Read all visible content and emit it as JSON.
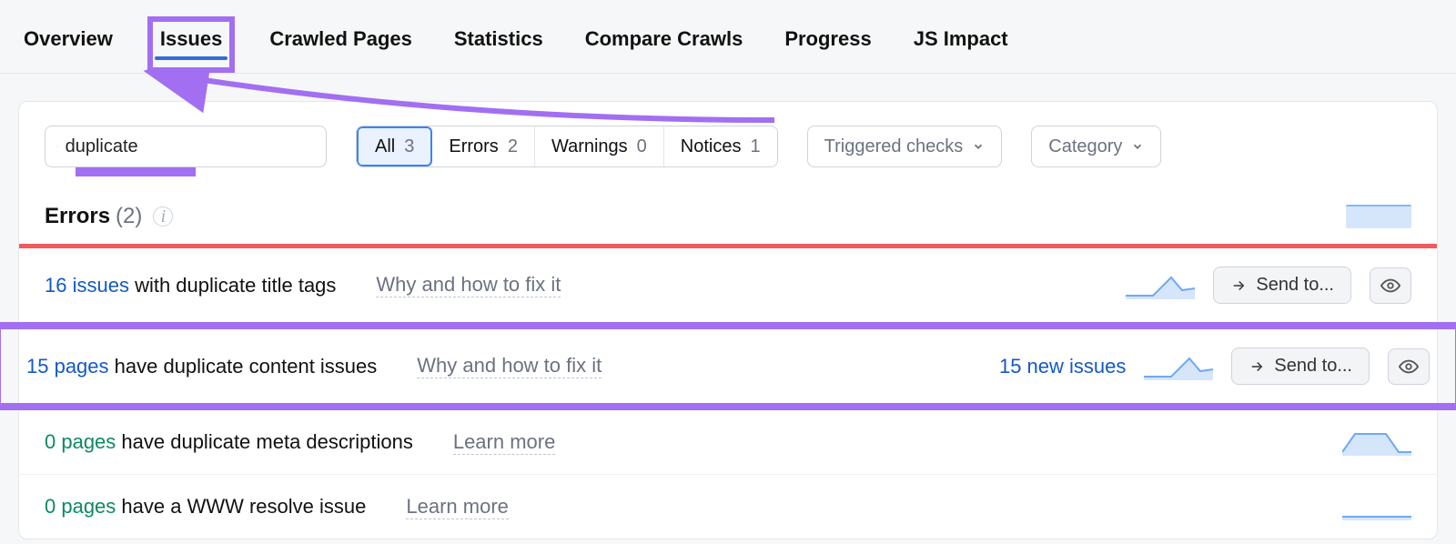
{
  "tabs": [
    "Overview",
    "Issues",
    "Crawled Pages",
    "Statistics",
    "Compare Crawls",
    "Progress",
    "JS Impact"
  ],
  "active_tab_index": 1,
  "search": {
    "value": "duplicate",
    "placeholder": "Search"
  },
  "filters": {
    "items": [
      {
        "label": "All",
        "count": 3
      },
      {
        "label": "Errors",
        "count": 2
      },
      {
        "label": "Warnings",
        "count": 0
      },
      {
        "label": "Notices",
        "count": 1
      }
    ],
    "active_index": 0
  },
  "dropdowns": {
    "triggered": "Triggered checks",
    "category": "Category"
  },
  "section": {
    "title": "Errors",
    "count_label": "(2)"
  },
  "rows": [
    {
      "count_text": "16 issues",
      "rest_text": " with duplicate title tags",
      "link_class": "link-blue",
      "hint": "Why and how to fix it",
      "new_issues": "",
      "show_actions": true,
      "highlight": false,
      "spark_type": "peak"
    },
    {
      "count_text": "15 pages",
      "rest_text": " have duplicate content issues",
      "link_class": "link-blue",
      "hint": "Why and how to fix it",
      "new_issues": "15 new issues",
      "show_actions": true,
      "highlight": true,
      "spark_type": "peak"
    },
    {
      "count_text": "0 pages",
      "rest_text": " have duplicate meta descriptions",
      "link_class": "link-green",
      "hint": "Learn more",
      "new_issues": "",
      "show_actions": false,
      "highlight": false,
      "spark_type": "plateau"
    },
    {
      "count_text": "0 pages",
      "rest_text": " have a WWW resolve issue",
      "link_class": "link-green",
      "hint": "Learn more",
      "new_issues": "",
      "show_actions": false,
      "highlight": false,
      "spark_type": "flat"
    }
  ],
  "actions": {
    "send_to": "Send to..."
  },
  "icons": {
    "search": "search-icon",
    "clear": "clear-icon",
    "chevron": "chevron-down-icon",
    "info": "info-icon",
    "arrow_send": "arrow-right-icon",
    "eye": "eye-icon"
  }
}
